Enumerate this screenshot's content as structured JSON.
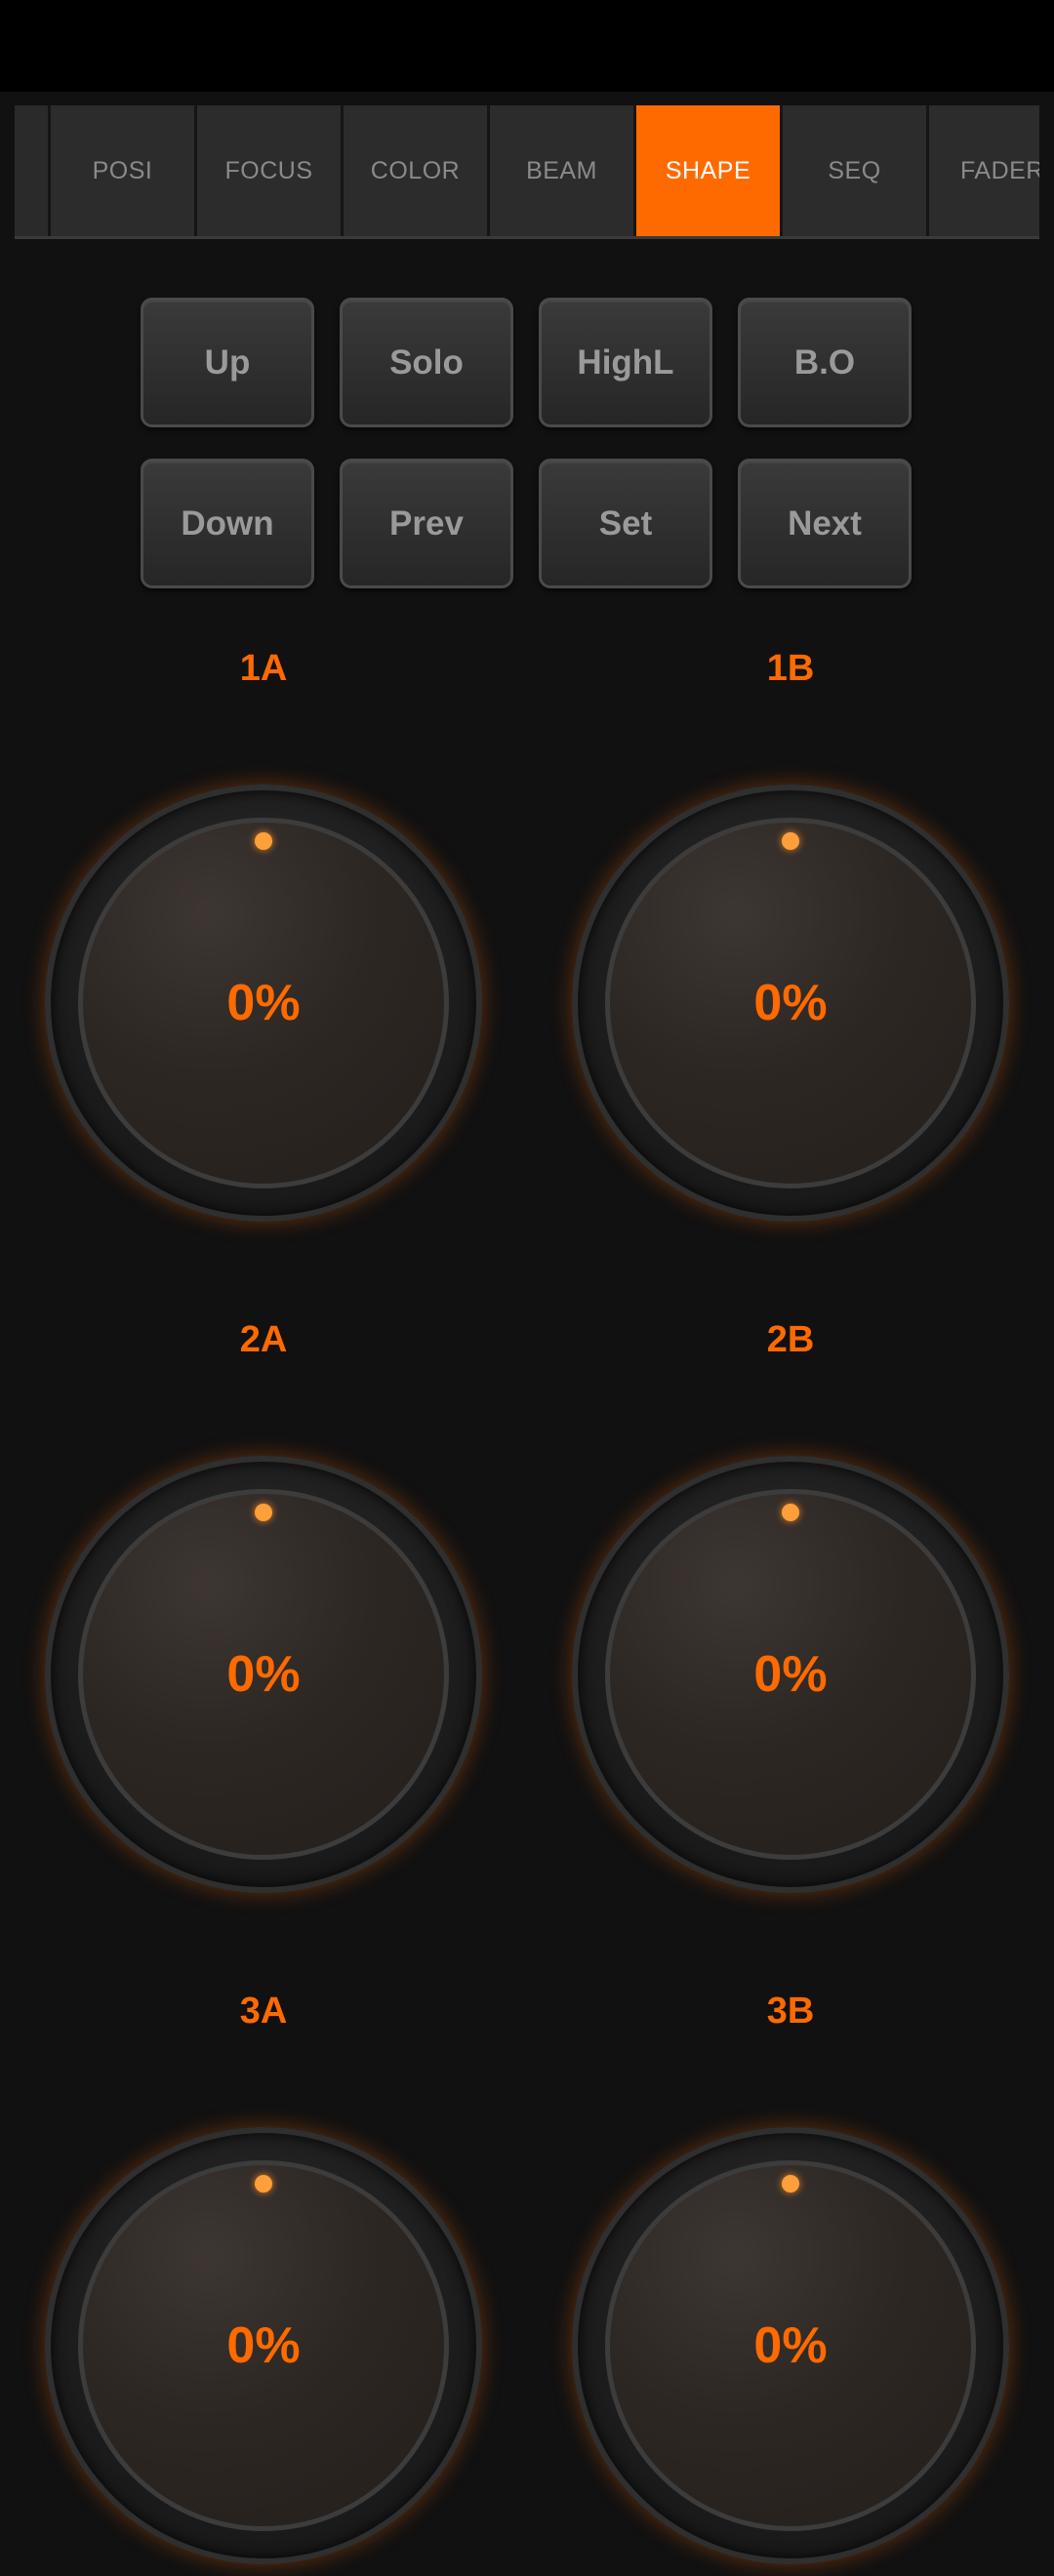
{
  "tabs": [
    {
      "label": "POSI",
      "active": false
    },
    {
      "label": "FOCUS",
      "active": false
    },
    {
      "label": "COLOR",
      "active": false
    },
    {
      "label": "BEAM",
      "active": false
    },
    {
      "label": "SHAPE",
      "active": true
    },
    {
      "label": "SEQ",
      "active": false
    },
    {
      "label": "FADER",
      "active": false
    }
  ],
  "buttons": {
    "up": "Up",
    "solo": "Solo",
    "highl": "HighL",
    "bo": "B.O",
    "down": "Down",
    "prev": "Prev",
    "set": "Set",
    "next": "Next"
  },
  "knobs": [
    {
      "label": "1A",
      "value": "0%"
    },
    {
      "label": "1B",
      "value": "0%"
    },
    {
      "label": "2A",
      "value": "0%"
    },
    {
      "label": "2B",
      "value": "0%"
    },
    {
      "label": "3A",
      "value": "0%"
    },
    {
      "label": "3B",
      "value": "0%"
    }
  ],
  "colors": {
    "accent": "#ff6a00",
    "background": "#111111",
    "indicator": "#ff9f3a"
  }
}
